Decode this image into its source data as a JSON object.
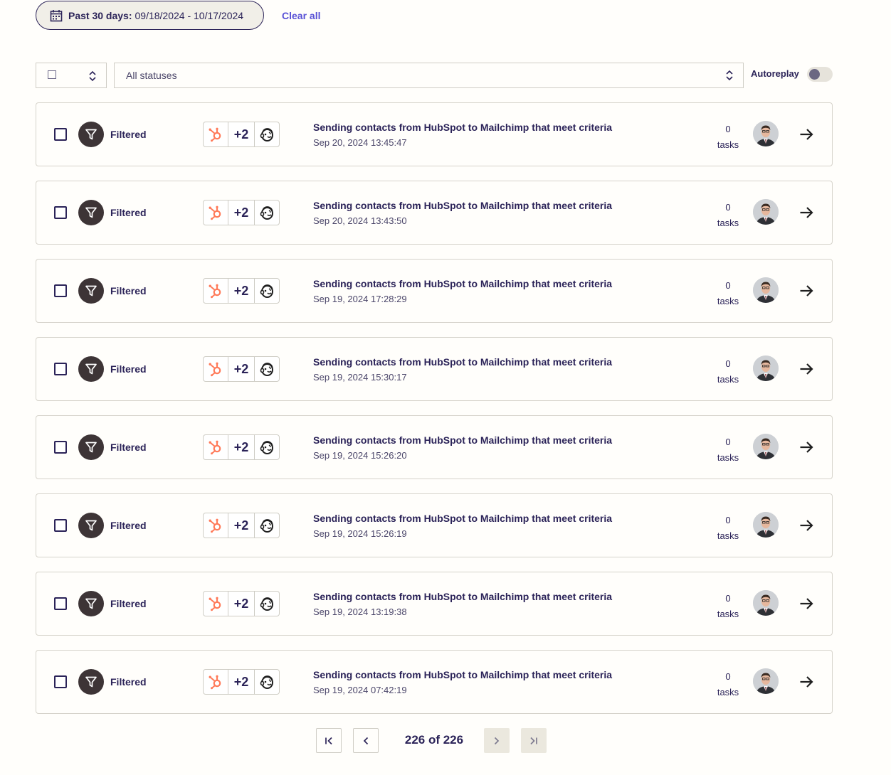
{
  "filters": {
    "date_prefix": "Past 30 days:",
    "date_range": "09/18/2024 - 10/17/2024",
    "clear_all": "Clear all",
    "status_select": "All statuses",
    "autoreplay_label": "Autoreplay",
    "autoreplay_on": false
  },
  "runs": [
    {
      "status": "Filtered",
      "extra_apps": "+2",
      "zap_name": "Sending contacts from HubSpot to Mailchimp that meet criteria",
      "date": "Sep 20, 2024 13:45:47",
      "task_count": "0",
      "task_label": "tasks"
    },
    {
      "status": "Filtered",
      "extra_apps": "+2",
      "zap_name": "Sending contacts from HubSpot to Mailchimp that meet criteria",
      "date": "Sep 20, 2024 13:43:50",
      "task_count": "0",
      "task_label": "tasks"
    },
    {
      "status": "Filtered",
      "extra_apps": "+2",
      "zap_name": "Sending contacts from HubSpot to Mailchimp that meet criteria",
      "date": "Sep 19, 2024 17:28:29",
      "task_count": "0",
      "task_label": "tasks"
    },
    {
      "status": "Filtered",
      "extra_apps": "+2",
      "zap_name": "Sending contacts from HubSpot to Mailchimp that meet criteria",
      "date": "Sep 19, 2024 15:30:17",
      "task_count": "0",
      "task_label": "tasks"
    },
    {
      "status": "Filtered",
      "extra_apps": "+2",
      "zap_name": "Sending contacts from HubSpot to Mailchimp that meet criteria",
      "date": "Sep 19, 2024 15:26:20",
      "task_count": "0",
      "task_label": "tasks"
    },
    {
      "status": "Filtered",
      "extra_apps": "+2",
      "zap_name": "Sending contacts from HubSpot to Mailchimp that meet criteria",
      "date": "Sep 19, 2024 15:26:19",
      "task_count": "0",
      "task_label": "tasks"
    },
    {
      "status": "Filtered",
      "extra_apps": "+2",
      "zap_name": "Sending contacts from HubSpot to Mailchimp that meet criteria",
      "date": "Sep 19, 2024 13:19:38",
      "task_count": "0",
      "task_label": "tasks"
    },
    {
      "status": "Filtered",
      "extra_apps": "+2",
      "zap_name": "Sending contacts from HubSpot to Mailchimp that meet criteria",
      "date": "Sep 19, 2024 07:42:19",
      "task_count": "0",
      "task_label": "tasks"
    }
  ],
  "pagination": {
    "page_info": "226 of 226"
  },
  "colors": {
    "accent": "#5851d6",
    "hubspot": "#ff7a59",
    "text": "#2b2358",
    "status_icon_bg": "#3d3436"
  }
}
